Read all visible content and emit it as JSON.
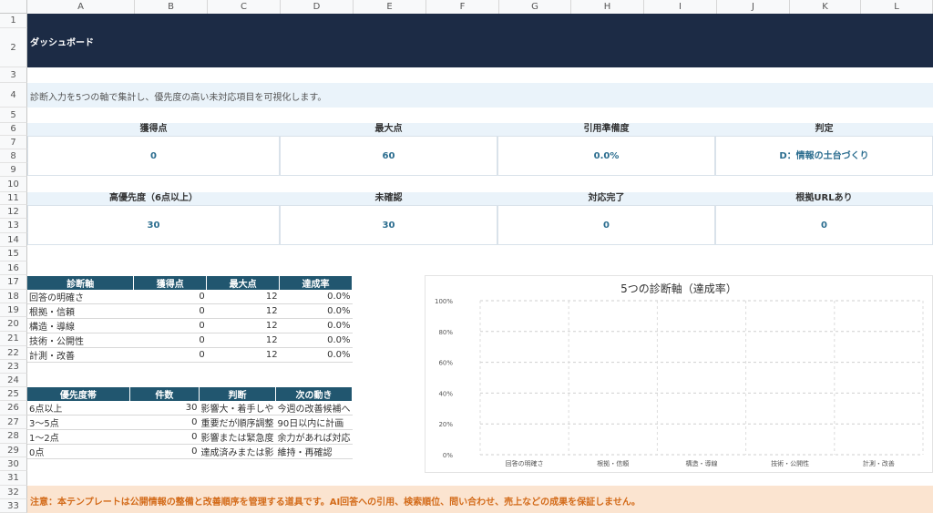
{
  "columns": [
    "A",
    "B",
    "C",
    "D",
    "E",
    "F",
    "G",
    "H",
    "I",
    "J",
    "K",
    "L"
  ],
  "rows": [
    "1",
    "2",
    "3",
    "4",
    "5",
    "6",
    "7",
    "8",
    "9",
    "10",
    "11",
    "12",
    "13",
    "14",
    "15",
    "16",
    "17",
    "18",
    "19",
    "20",
    "21",
    "22",
    "23",
    "24",
    "25",
    "26",
    "27",
    "28",
    "29",
    "30",
    "31",
    "32",
    "33"
  ],
  "header": {
    "title": "ダッシュボード",
    "description": "診断入力を5つの軸で集計し、優先度の高い未対応項目を可視化します。"
  },
  "kpi1": [
    {
      "label": "獲得点",
      "value": "0"
    },
    {
      "label": "最大点",
      "value": "60"
    },
    {
      "label": "引用準備度",
      "value": "0.0%"
    },
    {
      "label": "判定",
      "value": "D：情報の土台づくり"
    }
  ],
  "kpi2": [
    {
      "label": "高優先度（6点以上）",
      "value": "30"
    },
    {
      "label": "未確認",
      "value": "30"
    },
    {
      "label": "対応完了",
      "value": "0"
    },
    {
      "label": "根拠URLあり",
      "value": "0"
    }
  ],
  "axis_table": {
    "headers": [
      "診断軸",
      "獲得点",
      "最大点",
      "達成率"
    ],
    "rows": [
      [
        "回答の明確さ",
        "0",
        "12",
        "0.0%"
      ],
      [
        "根拠・信頼",
        "0",
        "12",
        "0.0%"
      ],
      [
        "構造・導線",
        "0",
        "12",
        "0.0%"
      ],
      [
        "技術・公開性",
        "0",
        "12",
        "0.0%"
      ],
      [
        "計測・改善",
        "0",
        "12",
        "0.0%"
      ]
    ]
  },
  "priority_table": {
    "headers": [
      "優先度帯",
      "件数",
      "判断",
      "次の動き"
    ],
    "rows": [
      [
        "6点以上",
        "30",
        "影響大・着手しや",
        "今週の改善候補へ"
      ],
      [
        "3〜5点",
        "0",
        "重要だが順序調整",
        "90日以内に計画"
      ],
      [
        "1〜2点",
        "0",
        "影響または緊急度",
        "余力があれば対応"
      ],
      [
        "0点",
        "0",
        "達成済みまたは影",
        "維持・再確認"
      ]
    ]
  },
  "note": "注意：本テンプレートは公開情報の整備と改善順序を管理する道具です。AI回答への引用、検索順位、問い合わせ、売上などの成果を保証しません。",
  "chart_data": {
    "type": "bar",
    "title": "5つの診断軸（達成率）",
    "categories": [
      "回答の明確さ",
      "根拠・信頼",
      "構造・導線",
      "技術・公開性",
      "計測・改善"
    ],
    "values": [
      0,
      0,
      0,
      0,
      0
    ],
    "ylim": [
      0,
      100
    ],
    "yticks": [
      "0%",
      "20%",
      "40%",
      "60%",
      "80%",
      "100%"
    ],
    "grid": true,
    "bar_color": "#21566f"
  }
}
